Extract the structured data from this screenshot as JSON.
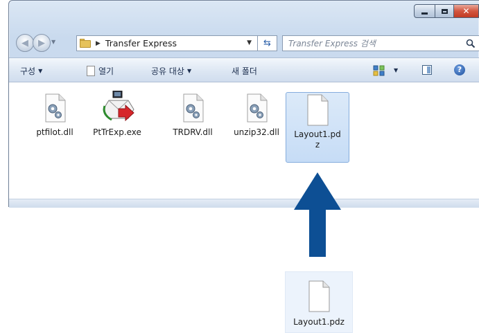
{
  "window": {
    "address": {
      "crumb": "Transfer Express"
    },
    "search": {
      "placeholder": "Transfer Express 검색"
    }
  },
  "toolbar": {
    "organize_label": "구성",
    "open_label": "열기",
    "share_label": "공유 대상",
    "new_folder_label": "새 폴더"
  },
  "files": [
    {
      "name": "ptfilot.dll",
      "icon": "dll-gear-icon"
    },
    {
      "name": "PtTrExp.exe",
      "icon": "transfer-express-app-icon"
    },
    {
      "name": "TRDRV.dll",
      "icon": "dll-gear-icon"
    },
    {
      "name": "unzip32.dll",
      "icon": "dll-gear-icon"
    },
    {
      "name": "Layout1.pdz",
      "label_line1": "Layout1.pd",
      "label_line2": "z",
      "icon": "blank-document-icon",
      "selected": true
    }
  ],
  "dragged_file": {
    "name": "Layout1.pdz",
    "icon": "blank-document-icon"
  },
  "colors": {
    "arrow": "#0d4f94",
    "selection": "#c6dcf6",
    "close_button": "#c23b23"
  }
}
